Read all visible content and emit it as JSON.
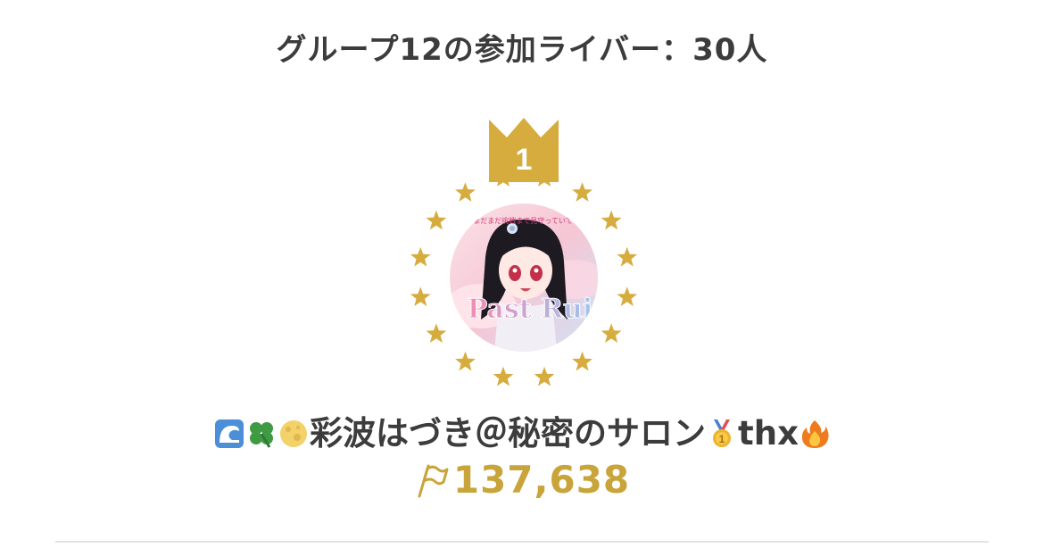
{
  "header": {
    "title": "グループ12の参加ライバー：30人"
  },
  "ranking": {
    "rank": "1",
    "crown_color": "#d6ac3e",
    "star_color": "#d6ac3e",
    "avatar": {
      "banner_text": "まだまだ挑戦まで見守っていて！",
      "logo_text": "Past Rui"
    },
    "name_prefix_icons": [
      "wave-icon",
      "four-leaf-clover-icon",
      "full-moon-icon"
    ],
    "name": "彩波はづき＠秘密のサロン",
    "name_suffix": "thx",
    "name_suffix_icons": [
      "first-place-medal-icon",
      "fire-icon"
    ],
    "score_icon": "flag-icon",
    "score": "137,638",
    "score_color": "#c9a43a"
  }
}
